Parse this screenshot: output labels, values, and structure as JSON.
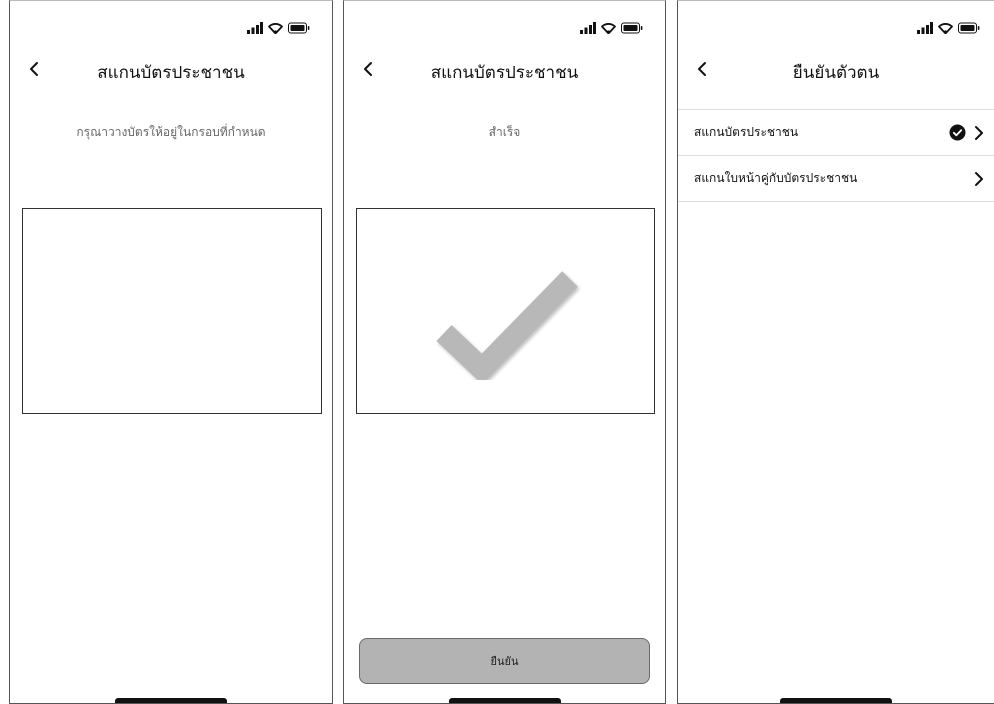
{
  "screens": [
    {
      "title": "สแกนบัตรประชาชน",
      "instruction": "กรุณาวางบัตรให้อยู่ในกรอบที่กำหนด",
      "back_icon": "chevron-left-icon"
    },
    {
      "title": "สแกนบัตรประชาชน",
      "status_text": "สำเร็จ",
      "confirm_label": "ยืนยัน",
      "back_icon": "chevron-left-icon",
      "success_icon": "checkmark-icon"
    },
    {
      "title": "ยืนยันตัวตน",
      "back_icon": "chevron-left-icon",
      "items": [
        {
          "label": "สแกนบัตรประชาชน",
          "completed": true
        },
        {
          "label": "สแกนใบหน้าคู่กับบัตรประชาชน",
          "completed": false
        }
      ]
    }
  ],
  "colors": {
    "button_fill": "#b3b3b3",
    "checkmark": "#b8b8b8",
    "border": "#333333",
    "divider": "#dddddd"
  }
}
